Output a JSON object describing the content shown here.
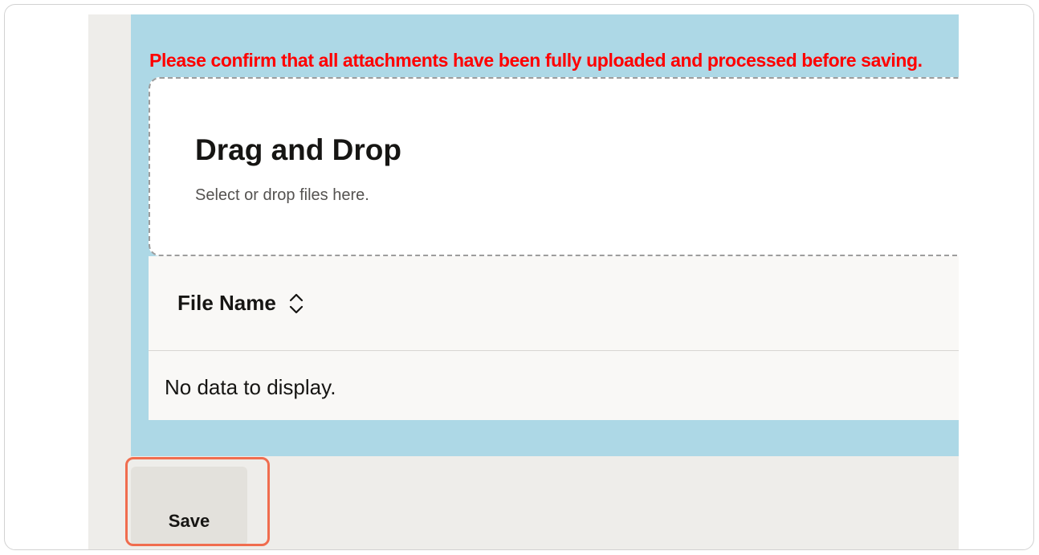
{
  "attachments": {
    "warning_text": "Please confirm that all attachments have been fully uploaded and processed before saving.",
    "dropzone": {
      "title": "Drag and Drop",
      "subtitle": "Select or drop files here."
    },
    "table": {
      "columns": [
        {
          "label": "File Name",
          "sort_icon": "sort-updown-icon"
        }
      ],
      "empty_text": "No data to display."
    }
  },
  "actions": {
    "save_label": "Save"
  },
  "colors": {
    "panel_bg": "#add8e6",
    "warning": "#ff0000",
    "highlight": "#f06d4f"
  }
}
